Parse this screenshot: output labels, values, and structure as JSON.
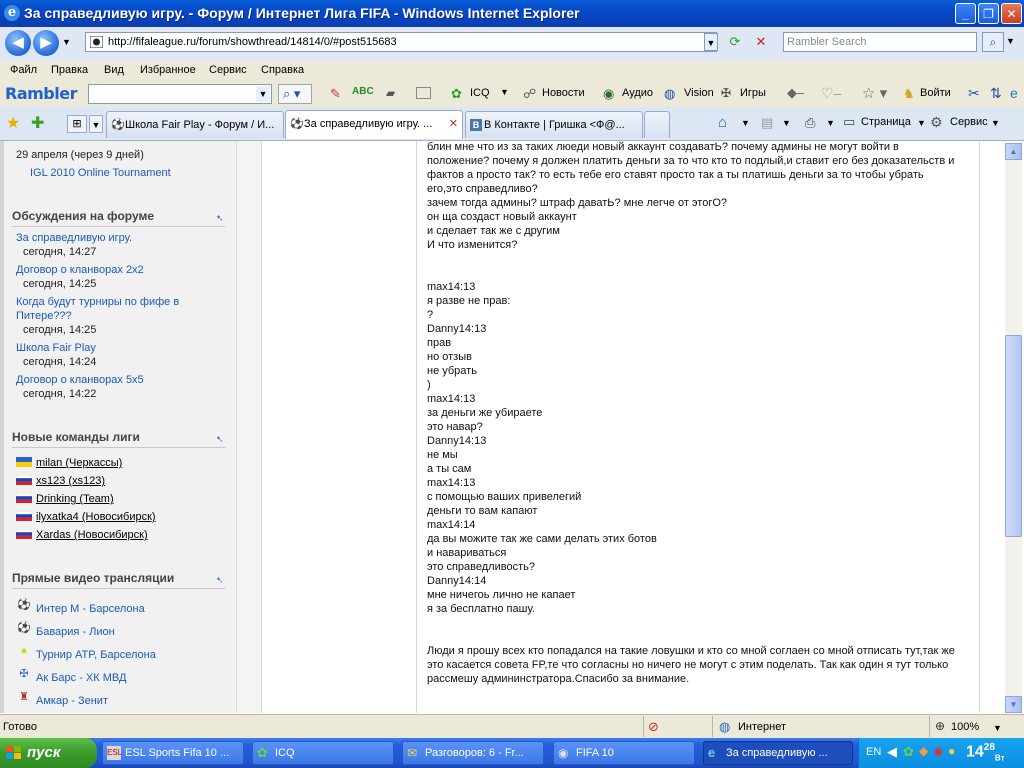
{
  "window": {
    "title": "За справедливую игру. - Форум / Интернет Лига FIFA - Windows Internet Explorer"
  },
  "address": {
    "url": "http://fifaleague.ru/forum/showthread/14814/0/#post515683"
  },
  "search": {
    "placeholder": "Rambler Search"
  },
  "menu": [
    "Файл",
    "Правка",
    "Вид",
    "Избранное",
    "Сервис",
    "Справка"
  ],
  "rambler_bar": {
    "logo": "Rambler",
    "items": [
      "ICQ",
      "Новости",
      "Аудио",
      "Vision",
      "Игры",
      "Войти"
    ]
  },
  "tabs": [
    {
      "label": "Школа Fair Play - Форум / И..."
    },
    {
      "label": "За справедливую игру. ..."
    },
    {
      "label": "В Контакте | Гришка <Ф@..."
    }
  ],
  "command_bar": {
    "page": "Страница",
    "tools": "Сервис"
  },
  "sidebar": {
    "event": {
      "date": "29 апреля (через 9 дней)",
      "name": "IGL 2010 Online Tournament"
    },
    "discussions": {
      "heading": "Обсуждения на форуме",
      "items": [
        {
          "title": "За справедливую игру.",
          "time": "сегодня, 14:27"
        },
        {
          "title": "Договор о кланворах 2х2",
          "time": "сегодня, 14:25"
        },
        {
          "title_line1": "Когда будут турниры по фифе в",
          "title_line2": "Питере???",
          "time": "сегодня, 14:25"
        },
        {
          "title": "Школа Fair Play",
          "time": "сегодня, 14:24"
        },
        {
          "title": "Договор о кланворах 5х5",
          "time": "сегодня, 14:22"
        }
      ]
    },
    "teams": {
      "heading": "Новые команды лиги",
      "items": [
        {
          "name": "milan (Черкассы)",
          "flag": "ukraine"
        },
        {
          "name": "xs123 (xs123)",
          "flag": "russia"
        },
        {
          "name": "Drinking (Team)",
          "flag": "russia"
        },
        {
          "name": "ilyxatka4 (Новосибирск)",
          "flag": "russia"
        },
        {
          "name": "Xardas (Новосибирск)",
          "flag": "russia"
        }
      ]
    },
    "streams": {
      "heading": "Прямые видео трансляции",
      "items": [
        {
          "title": "Интер М - Барселона",
          "icon": "soccer-ball-icon"
        },
        {
          "title": "Бавария - Лион",
          "icon": "soccer-ball-icon"
        },
        {
          "title": "Турнир ATP, Барселона",
          "icon": "tennis-ball-icon"
        },
        {
          "title": "Ак Барс - ХК МВД",
          "icon": "hockey-icon"
        },
        {
          "title": "Амкар - Зенит",
          "icon": "soccer-icon"
        }
      ]
    }
  },
  "post": {
    "lines": [
      "блин мне что из за таких люеди новый аккаунт создаватЬ? почему админы не могут войти в",
      "положение? почему я должен платить деньги за то что кто то подлый,и ставит его без доказательств и",
      "фактов а просто так? то есть тебе его ставят просто так а ты платишь деньги за то чтобы убрать",
      "его,это справедливо?",
      "зачем тогда админы? штраф даватЬ? мне легче от этогО?",
      "он ща создаст новый аккаунт",
      "и сделает так же с другим",
      "И что изменится?",
      "max14:13",
      "я разве не прав:",
      "?",
      "Danny14:13",
      "прав",
      "но отзыв",
      "не убрать",
      ")",
      "max14:13",
      "за деньги же убираете",
      "это навар?",
      "Danny14:13",
      "не мы",
      "а ты сам",
      "max14:13",
      "с помощью ваших привелегий",
      "деньги то вам капают",
      "max14:14",
      "да вы можите так же сами делать этих ботов",
      "и навариваться",
      "это справедливость?",
      "Danny14:14",
      "мне ничегоь лично не капает",
      "я за бесплатно пашу.",
      "Люди я прошу всех кто попадался на такие ловушки и кто со мной соглаен со мной отписать тут,так же",
      "это касается совета FP,те что согласны но ничего не могут с этим поделать. Так как один я тут только",
      "рассмешу админинстратора.Спасибо за внимание."
    ]
  },
  "status": {
    "text": "Готово",
    "zone": "Интернет",
    "zoom": "100%"
  },
  "taskbar": {
    "start": "пуск",
    "buttons": [
      "ESL Sports Fifa 10 ...",
      "ICQ",
      "Разговоров: 6 - Fr...",
      "FIFA 10",
      "За справедливую ..."
    ],
    "lang": "EN",
    "clock": "14",
    "clock_minutes": "28",
    "clock_day": "Вт"
  }
}
